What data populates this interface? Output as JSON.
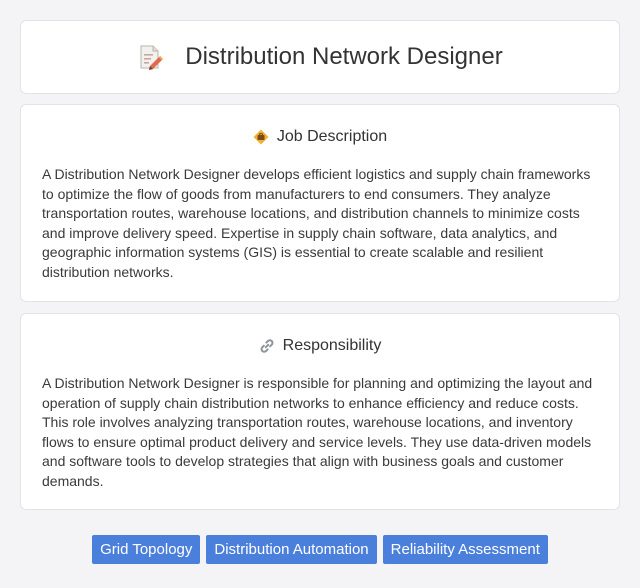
{
  "header": {
    "title": "Distribution Network Designer",
    "icon": "document-pencil-icon"
  },
  "job_description": {
    "heading": "Job Description",
    "icon": "briefcase-badge-icon",
    "text": "A Distribution Network Designer develops efficient logistics and supply chain frameworks to optimize the flow of goods from manufacturers to end consumers. They analyze transportation routes, warehouse locations, and distribution channels to minimize costs and improve delivery speed. Expertise in supply chain software, data analytics, and geographic information systems (GIS) is essential to create scalable and resilient distribution networks."
  },
  "responsibility": {
    "heading": "Responsibility",
    "icon": "link-icon",
    "text": "A Distribution Network Designer is responsible for planning and optimizing the layout and operation of supply chain distribution networks to enhance efficiency and reduce costs. This role involves analyzing transportation routes, warehouse locations, and inventory flows to ensure optimal product delivery and service levels. They use data-driven models and software tools to develop strategies that align with business goals and customer demands."
  },
  "tags": [
    {
      "label": "Grid Topology"
    },
    {
      "label": "Distribution Automation"
    },
    {
      "label": "Reliability Assessment"
    }
  ],
  "colors": {
    "background": "#f4f4f6",
    "tag_background": "#4a7fdc",
    "tag_text": "#ffffff"
  }
}
